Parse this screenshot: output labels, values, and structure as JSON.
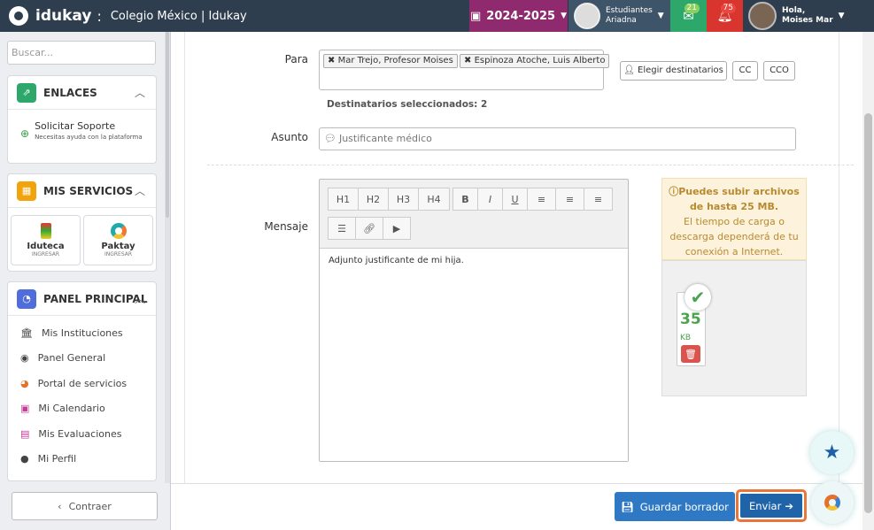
{
  "topbar": {
    "brand": "idukay",
    "brand_sep": ":",
    "school": "Colegio México | Idukay",
    "year": "2024-2025",
    "students_label": "Estudiantes",
    "student_name": "Ariadna",
    "messages_count": "21",
    "notifications_count": "75",
    "greeting": "Hola,",
    "user_name": "Moises Mar",
    "colors": {
      "bar": "#2f3e4f",
      "year": "#8e2a6d",
      "messages": "#2ea86a",
      "notifications": "#d9352f"
    }
  },
  "sidebar": {
    "search_placeholder": "Buscar...",
    "links_title": "ENLACES",
    "support_title": "Solicitar Soporte",
    "support_desc": "Necesitas ayuda con la plataforma",
    "services_title": "MIS SERVICIOS",
    "services": [
      {
        "name": "Iduteca",
        "action": "INGRESAR"
      },
      {
        "name": "Paktay",
        "action": "INGRESAR"
      }
    ],
    "panel_title": "PANEL PRINCIPAL",
    "panel_items": [
      {
        "label": "Mis Instituciones",
        "icon": "institution-icon"
      },
      {
        "label": "Panel General",
        "icon": "dashboard-icon"
      },
      {
        "label": "Portal de servicios",
        "icon": "services-portal-icon"
      },
      {
        "label": "Mi Calendario",
        "icon": "calendar-icon"
      },
      {
        "label": "Mis Evaluaciones",
        "icon": "evaluations-icon"
      },
      {
        "label": "Mi Perfil",
        "icon": "user-icon"
      }
    ],
    "collapse_label": "Contraer"
  },
  "form": {
    "to_label": "Para",
    "recipients": [
      "Mar Trejo, Profesor Moises",
      "Espinoza Atoche, Luis Alberto"
    ],
    "choose_recipients_label": "Elegir destinatarios",
    "cc_label": "CC",
    "bcc_label": "CCO",
    "selected_recipients": "Destinatarios seleccionados: 2",
    "subject_label": "Asunto",
    "subject_value": "Justificante médico",
    "message_label": "Mensaje",
    "toolbar_row1": [
      "H1",
      "H2",
      "H3",
      "H4",
      "B",
      "I",
      "U",
      "≡",
      "≡",
      "≡"
    ],
    "message_body": "Adjunto justificante de mi hija.",
    "upload_info_bold1": "Puedes subir archivos",
    "upload_info_bold2": "de hasta 25 MB.",
    "upload_info_text1": "El tiempo de carga o",
    "upload_info_text2": "descarga dependerá de tu",
    "upload_info_text3": "conexión a Internet.",
    "file_size": "35",
    "file_unit": "KB"
  },
  "footer": {
    "save_draft_label": "Guardar borrador",
    "send_label": "Enviar"
  }
}
